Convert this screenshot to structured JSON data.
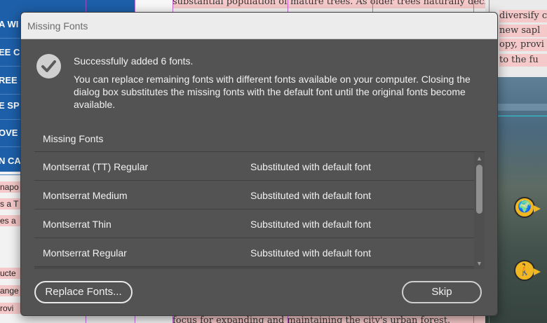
{
  "background": {
    "nav_items": [
      "A WI",
      "EE C",
      "REE C",
      "E SP",
      "OVE",
      "N CA"
    ],
    "snippets": [
      "napo",
      "s a T",
      "es a",
      "ucte",
      "ange",
      "rovi"
    ],
    "page_text_top": "substantial population of mature trees. As older trees naturally decline or",
    "page_text_lines": [
      "diversify ca",
      "new sapl",
      "opy, provi",
      "to the fu"
    ],
    "page_text_bottom": "focus for expanding and maintaining the city's urban forest.",
    "markers": [
      "globe-marker",
      "walking-person-marker"
    ]
  },
  "dialog": {
    "title": "Missing Fonts",
    "success_message": "Successfully added 6 fonts.",
    "detail_message": "You can replace remaining fonts with different fonts available on your computer. Closing the dialog box substitutes the missing fonts with the default font until the original fonts become available.",
    "list_heading": "Missing Fonts",
    "fonts": [
      {
        "name": "Montserrat (TT) Regular",
        "status": "Substituted with default font"
      },
      {
        "name": "Montserrat Medium",
        "status": "Substituted with default font"
      },
      {
        "name": "Montserrat Thin",
        "status": "Substituted with default font"
      },
      {
        "name": "Montserrat Regular",
        "status": "Substituted with default font"
      }
    ],
    "replace_button": "Replace Fonts...",
    "skip_button": "Skip"
  },
  "colors": {
    "dialog_bg": "#535353",
    "titlebar_bg": "#ececec",
    "nav_blue": "#1d5fa8",
    "highlight_pink": "#f5c9c9",
    "guide_purple": "#b54bd6",
    "marker_yellow": "#f0b722"
  }
}
